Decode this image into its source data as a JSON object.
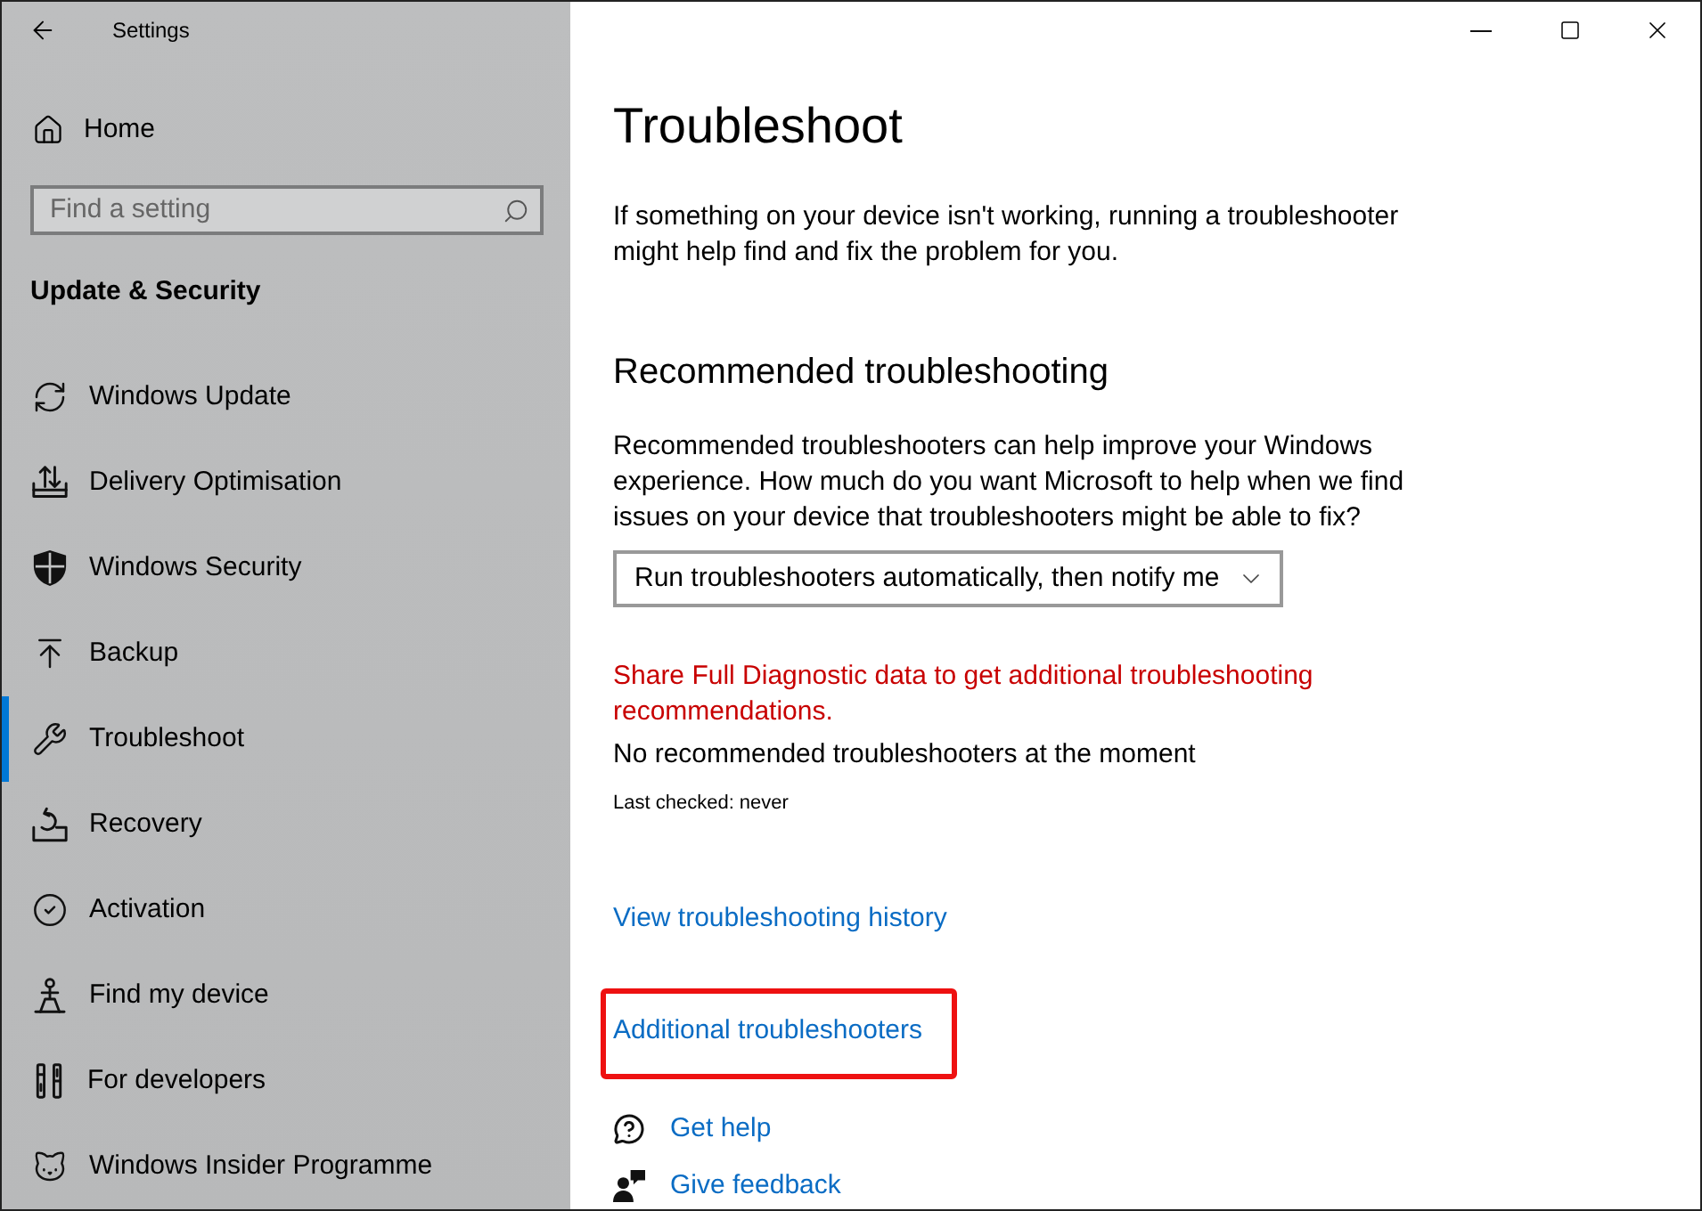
{
  "window": {
    "title": "Settings"
  },
  "sidebar": {
    "home": {
      "label": "Home"
    },
    "search": {
      "placeholder": "Find a setting"
    },
    "section_title": "Update & Security",
    "items": [
      {
        "label": "Windows Update",
        "selected": false
      },
      {
        "label": "Delivery Optimisation",
        "selected": false
      },
      {
        "label": "Windows Security",
        "selected": false
      },
      {
        "label": "Backup",
        "selected": false
      },
      {
        "label": "Troubleshoot",
        "selected": true
      },
      {
        "label": "Recovery",
        "selected": false
      },
      {
        "label": "Activation",
        "selected": false
      },
      {
        "label": "Find my device",
        "selected": false
      },
      {
        "label": "For developers",
        "selected": false
      },
      {
        "label": "Windows Insider Programme",
        "selected": false
      }
    ]
  },
  "page": {
    "title": "Troubleshoot",
    "intro": "If something on your device isn't working, running a troubleshooter might help find and fix the problem for you."
  },
  "recommended": {
    "heading": "Recommended troubleshooting",
    "description": "Recommended troubleshooters can help improve your Windows experience. How much do you want Microsoft to help when we find issues on your device that troubleshooters might be able to fix?",
    "dropdown": {
      "value": "Run troubleshooters automatically, then notify me"
    },
    "diagnostic_link": "Share Full Diagnostic data to get additional troubleshooting recommendations.",
    "status": "No recommended troubleshooters at the moment",
    "last_checked": "Last checked: never"
  },
  "links": [
    {
      "label": "View troubleshooting history",
      "highlighted": false
    },
    {
      "label": "Additional troubleshooters",
      "highlighted": true
    }
  ],
  "help_links": [
    {
      "label": "Get help"
    },
    {
      "label": "Give feedback"
    }
  ]
}
